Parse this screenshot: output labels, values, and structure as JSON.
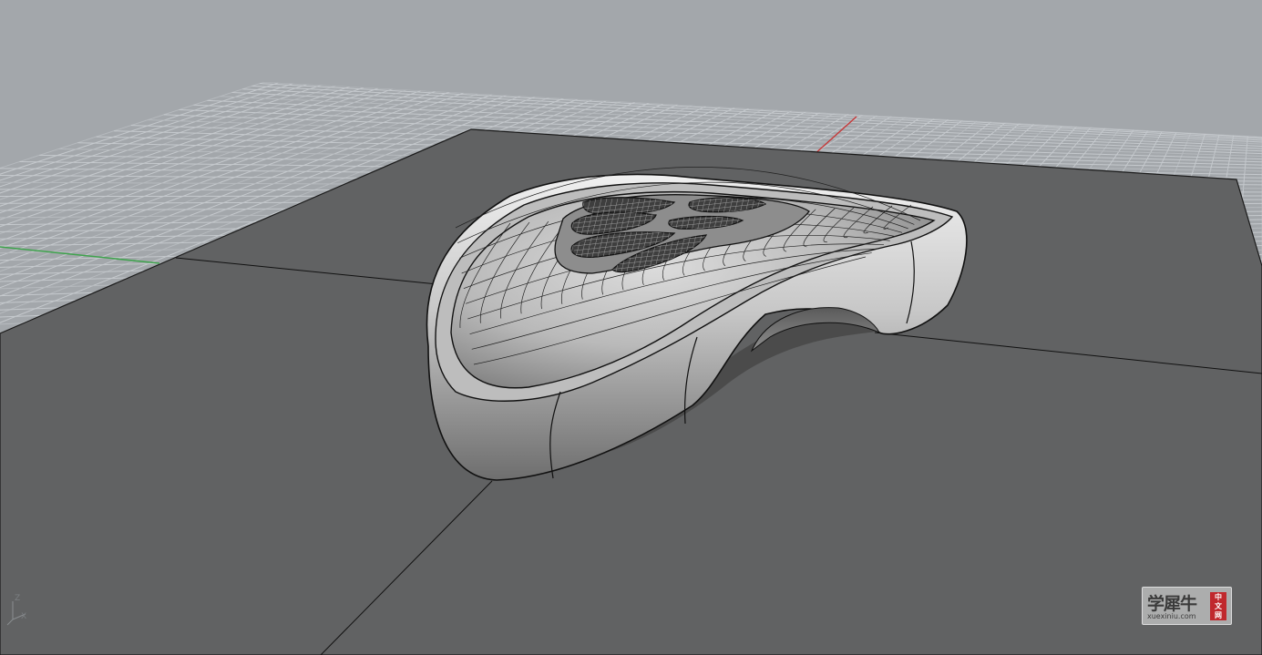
{
  "viewport": {
    "projection": "perspective",
    "display_mode": "shaded",
    "colors": {
      "background": "#a3a7ab",
      "grid_line": "#c5c9cd",
      "grid_major": "#b6babe",
      "floor_plane": "#616263",
      "x_axis": "#c53a3a",
      "y_axis": "#3fa34d",
      "model_light": "#d9d9d9",
      "model_dark": "#6f6f6f"
    },
    "axis_widget": {
      "z_label": "Z",
      "x_label": "X"
    }
  },
  "watermark": {
    "title": "学犀牛",
    "url": "xuexiniu.com",
    "stamp": [
      "中",
      "文",
      "网"
    ]
  }
}
